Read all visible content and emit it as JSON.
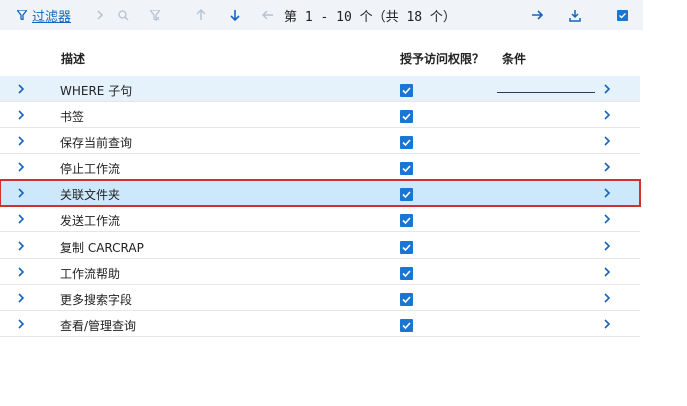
{
  "toolbar": {
    "filter_label": "过滤器",
    "pager_text": "第  1 - 10 个（共 18 个）"
  },
  "header": {
    "description": "描述",
    "access": "授予访问权限？",
    "condition": "条件"
  },
  "rows": [
    {
      "label": "WHERE 子句",
      "checked": true
    },
    {
      "label": "书签",
      "checked": true
    },
    {
      "label": "保存当前查询",
      "checked": true
    },
    {
      "label": "停止工作流",
      "checked": true
    },
    {
      "label": "关联文件夹",
      "checked": true
    },
    {
      "label": "发送工作流",
      "checked": true
    },
    {
      "label": "复制 CARCRAP",
      "checked": true
    },
    {
      "label": "工作流帮助",
      "checked": true
    },
    {
      "label": "更多搜索字段",
      "checked": true
    },
    {
      "label": "查看/管理查询",
      "checked": true
    }
  ],
  "colors": {
    "accent": "#1565c0",
    "selected_outline": "#d32f2f",
    "selected_bg": "#cde8fb"
  }
}
